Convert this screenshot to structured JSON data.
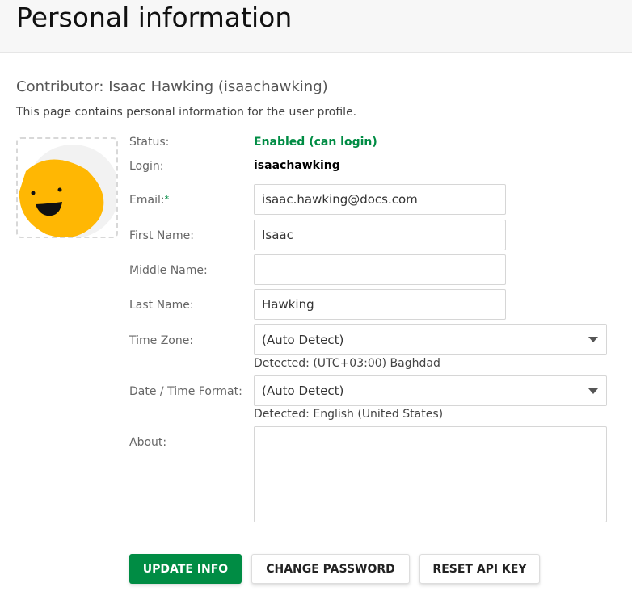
{
  "header": {
    "title": "Personal information"
  },
  "profile": {
    "heading": "Contributor: Isaac Hawking (isaachawking)",
    "description": "This page contains personal information for the user profile."
  },
  "colors": {
    "accent": "#008c44",
    "avatar": "#ffb703"
  },
  "labels": {
    "status": "Status:",
    "login": "Login:",
    "email": "Email:",
    "required": "*",
    "first_name": "First Name:",
    "middle_name": "Middle Name:",
    "last_name": "Last Name:",
    "time_zone": "Time Zone:",
    "date_format": "Date / Time Format:",
    "about": "About:"
  },
  "values": {
    "status": "Enabled (can login)",
    "login": "isaachawking",
    "email": "isaac.hawking@docs.com",
    "first_name": "Isaac",
    "middle_name": "",
    "last_name": "Hawking",
    "time_zone": "(Auto Detect)",
    "time_zone_detected": "Detected: (UTC+03:00) Baghdad",
    "date_format": "(Auto Detect)",
    "date_format_detected": "Detected: English (United States)",
    "about": ""
  },
  "buttons": {
    "update": "UPDATE INFO",
    "change_password": "CHANGE PASSWORD",
    "reset_api": "RESET API KEY"
  }
}
